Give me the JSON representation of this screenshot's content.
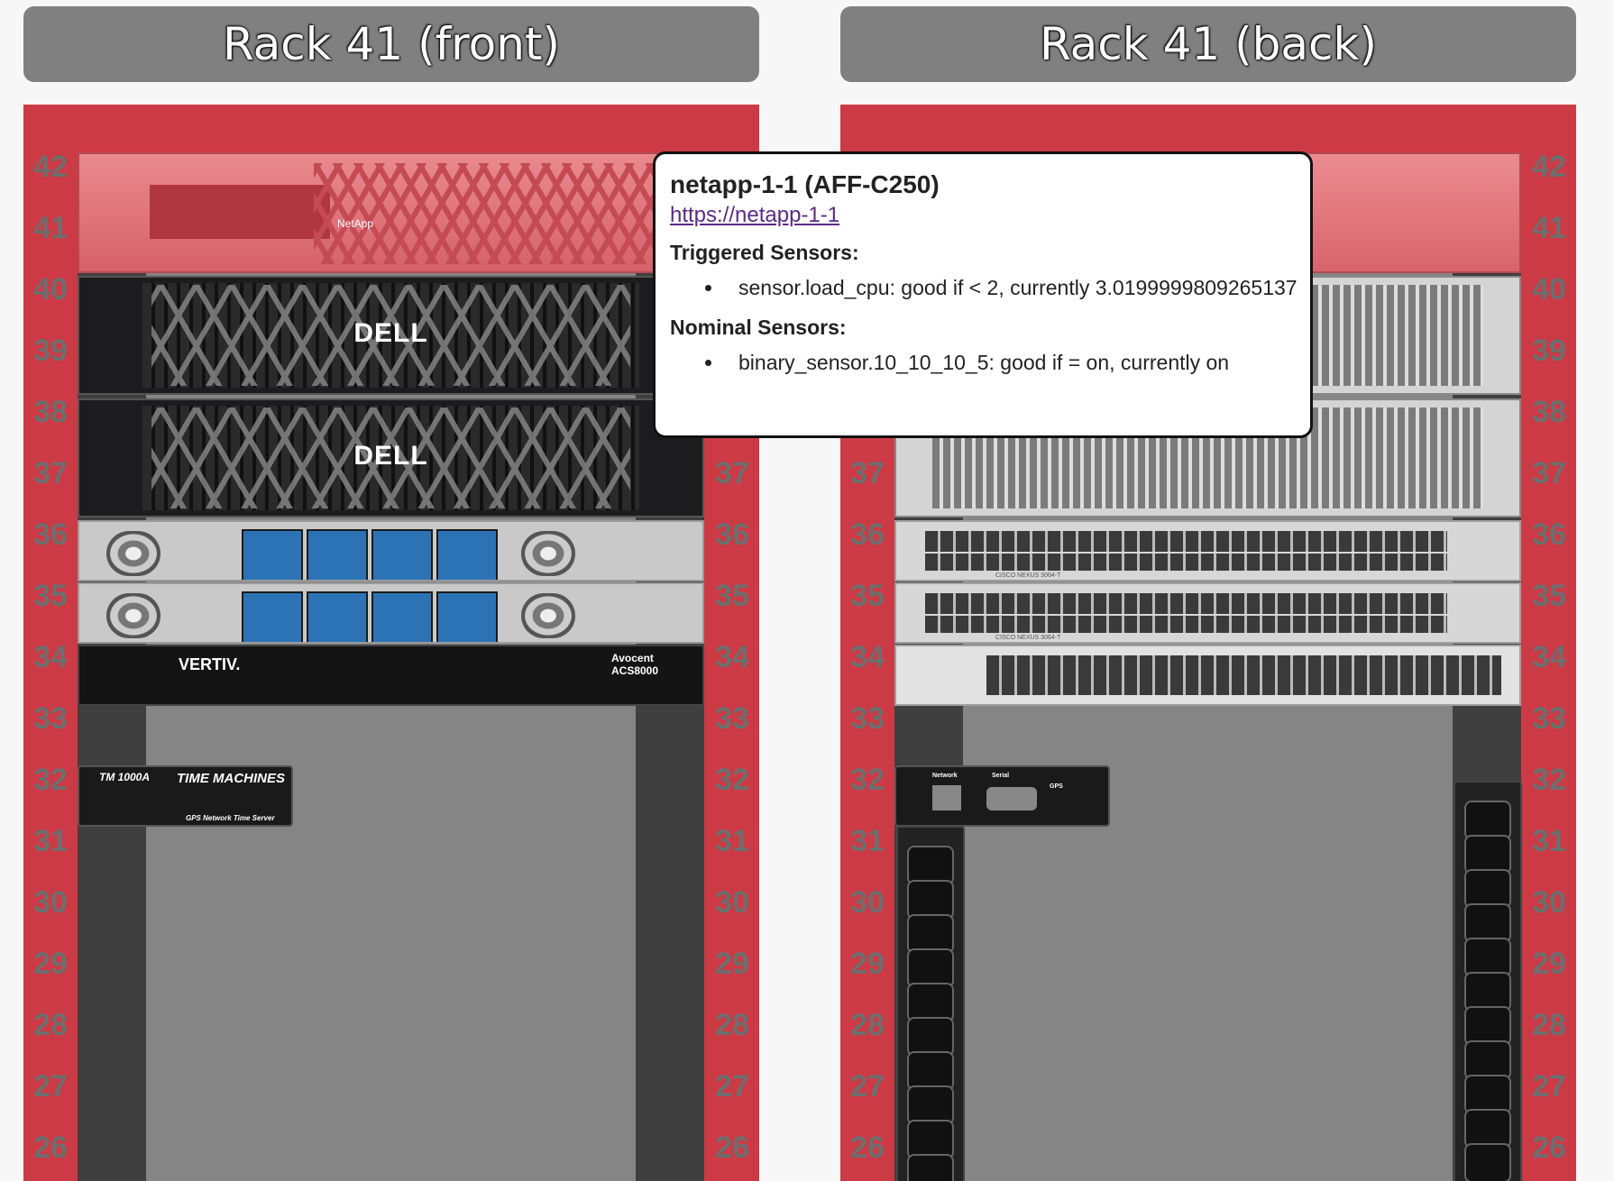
{
  "front": {
    "title": "Rack 41 (front)",
    "units": [
      "42",
      "41",
      "40",
      "39",
      "38",
      "37",
      "36",
      "35",
      "34",
      "33",
      "32",
      "31",
      "30",
      "29",
      "28",
      "27",
      "26"
    ],
    "devices": {
      "netapp_logo": "NetApp",
      "dell_logo": "DELL",
      "vertiv_logo": "VERTIV.",
      "vertiv_model": "Avocent ACS8000",
      "tm_model": "TM 1000A",
      "tm_brand": "TIME MACHINES",
      "tm_sub": "GPS Network Time Server"
    }
  },
  "back": {
    "title": "Rack 41 (back)",
    "units": [
      "42",
      "41",
      "40",
      "39",
      "38",
      "37",
      "36",
      "35",
      "34",
      "33",
      "32",
      "31",
      "30",
      "29",
      "28",
      "27",
      "26"
    ],
    "devices": {
      "cisco_label": "CISCO NEXUS 3064-T",
      "gps_network": "Network",
      "gps_serial": "Serial",
      "gps_label": "GPS"
    }
  },
  "tooltip": {
    "title": "netapp-1-1 (AFF-C250)",
    "link": "https://netapp-1-1",
    "triggered_heading": "Triggered Sensors:",
    "triggered": [
      "sensor.load_cpu: good if < 2, currently 3.0199999809265137"
    ],
    "nominal_heading": "Nominal Sensors:",
    "nominal": [
      "binary_sensor.10_10_10_5: good if = on, currently on"
    ]
  },
  "colors": {
    "rack": "#cc3a45",
    "header": "#808080",
    "tooltip_link": "#5b2a86"
  }
}
